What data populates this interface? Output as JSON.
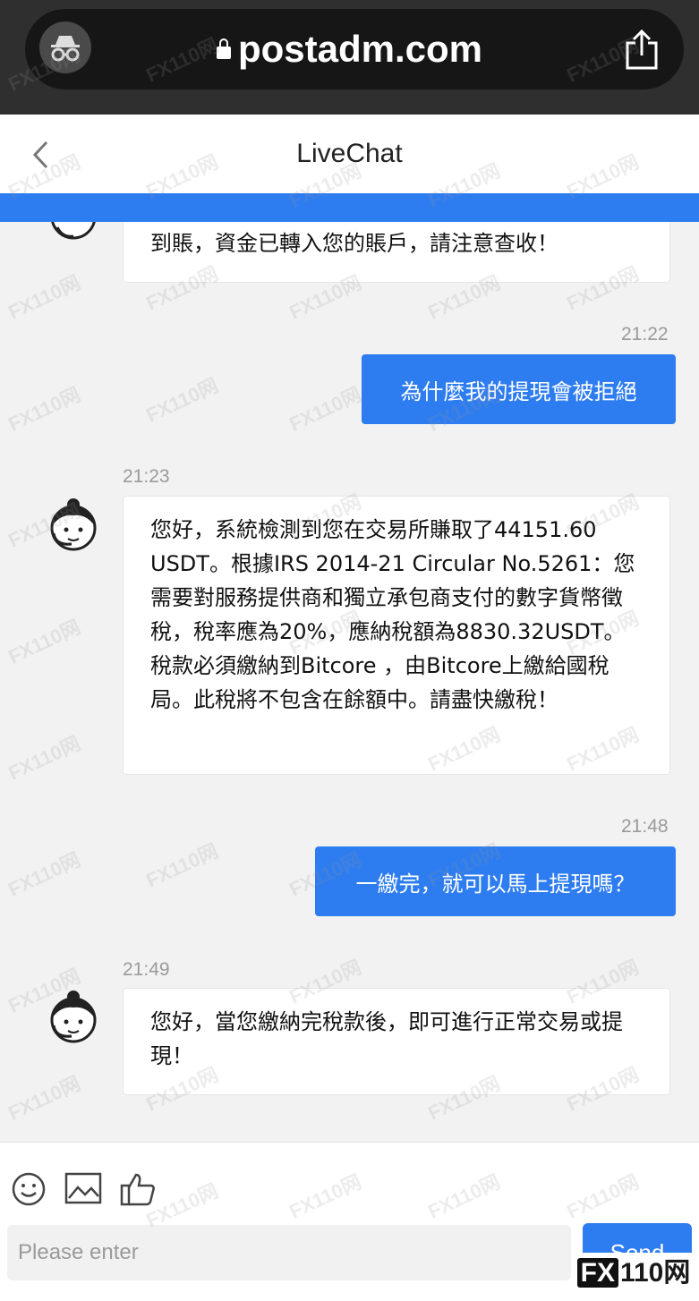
{
  "browser": {
    "url": "postadm.com"
  },
  "header": {
    "title": "LiveChat"
  },
  "messages": [
    {
      "from": "agent",
      "text": "到賬，資金已轉入您的賬戶，請注意查收！"
    },
    {
      "from": "user",
      "time": "21:22",
      "text": "為什麼我的提現會被拒絕"
    },
    {
      "from": "agent",
      "time": "21:23",
      "text": "您好，系統檢測到您在交易所賺取了44151.60 USDT。根據IRS 2014-21 Circular No.5261：您需要對服務提供商和獨立承包商支付的數字貨幣徵稅，稅率應為20%，應納稅額為8830.32USDT。稅款必須繳納到Bitcore ，由Bitcore上繳給國稅局。此稅將不包含在餘額中。請盡快繳稅！"
    },
    {
      "from": "user",
      "time": "21:48",
      "text": "一繳完，就可以馬上提現嗎？"
    },
    {
      "from": "agent",
      "time": "21:49",
      "text": "您好，當您繳納完稅款後，即可進行正常交易或提現！"
    }
  ],
  "composer": {
    "placeholder": "Please enter",
    "send_label": "Send"
  },
  "watermark": {
    "text": "FX110网",
    "logo_prefix": "FX",
    "logo_suffix": "110网"
  },
  "colors": {
    "accent": "#2e7df0",
    "browser_bar": "#2f2f2f",
    "background": "#f2f2f2"
  },
  "icons": {
    "emoji": "smile-icon",
    "image": "image-icon",
    "like": "thumbs-up-icon",
    "back": "chevron-left-icon",
    "share": "share-icon",
    "incognito": "incognito-icon",
    "lock": "lock-icon"
  }
}
